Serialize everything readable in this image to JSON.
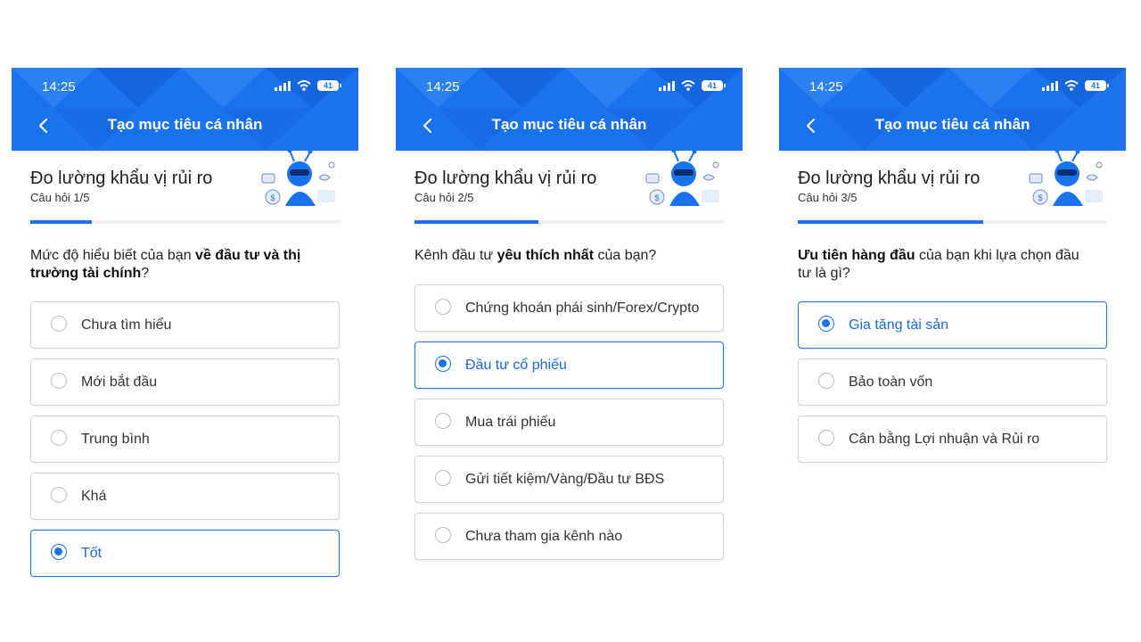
{
  "screens": [
    {
      "status": {
        "time": "14:25",
        "battery": "41"
      },
      "header": {
        "title": "Tạo mục tiêu cá nhân"
      },
      "section_title": "Đo lường khẩu vị rủi ro",
      "question_count": "Câu hỏi 1/5",
      "progress": 0.2,
      "question": {
        "pre": "Mức độ hiểu biết của bạn ",
        "bold": "về đầu tư và thị trường tài chính",
        "post": "?"
      },
      "options": [
        "Chưa tìm hiểu",
        "Mới bắt đầu",
        "Trung bình",
        "Khá",
        "Tốt"
      ],
      "selected_index": 4
    },
    {
      "status": {
        "time": "14:25",
        "battery": "41"
      },
      "header": {
        "title": "Tạo mục tiêu cá nhân"
      },
      "section_title": "Đo lường khẩu vị rủi ro",
      "question_count": "Câu hỏi 2/5",
      "progress": 0.4,
      "question": {
        "pre": "Kênh đầu tư ",
        "bold": "yêu thích nhất",
        "post": " của bạn?"
      },
      "options": [
        "Chứng khoán phái sinh/Forex/Crypto",
        "Đầu tư cổ phiếu",
        "Mua trái phiếu",
        "Gửi tiết kiệm/Vàng/Đầu tư BĐS",
        "Chưa tham gia kênh nào"
      ],
      "selected_index": 1
    },
    {
      "status": {
        "time": "14:25",
        "battery": "41"
      },
      "header": {
        "title": "Tạo mục tiêu cá nhân"
      },
      "section_title": "Đo lường khẩu vị rủi ro",
      "question_count": "Câu hỏi 3/5",
      "progress": 0.6,
      "question": {
        "pre": "",
        "bold": "Ưu tiên hàng đầu",
        "post": " của bạn khi lựa chọn đầu tư là gì?"
      },
      "options": [
        "Gia tăng tài sản",
        "Bảo toàn vốn",
        "Cân bằng Lợi nhuận và Rủi ro"
      ],
      "selected_index": 0
    }
  ],
  "colors": {
    "primary": "#1a73ee",
    "option_border": "#cfd3d8",
    "selected_text": "#1a6ad8"
  },
  "icons": {
    "back": "chevron-left-icon",
    "signal": "signal-icon",
    "wifi": "wifi-icon",
    "battery": "battery-icon",
    "mascot": "ant-mascot-icon"
  }
}
